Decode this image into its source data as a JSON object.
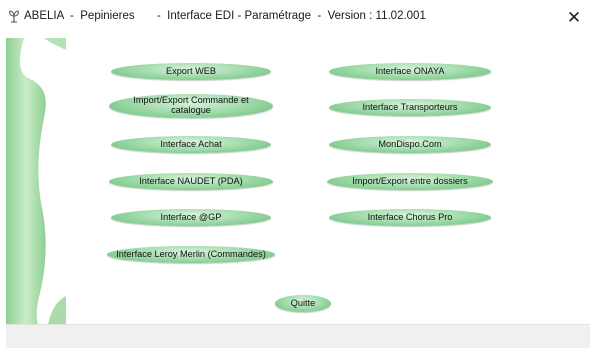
{
  "window": {
    "title": "ABELIA  -  Pepinieres       -  Interface EDI - Paramétrage  -  Version : 11.02.001",
    "app_icon": "plant-icon",
    "close_symbol": "✕"
  },
  "menu": {
    "left": [
      "Export WEB",
      "Import/Export Commande et catalogue",
      "Interface Achat",
      "Interface NAUDET  (PDA)",
      "Interface @GP",
      "Interface Leroy Merlin (Commandes)"
    ],
    "right": [
      "Interface ONAYA",
      "Interface Transporteurs",
      "MonDispo.Com",
      "Import/Export entre dossiers",
      "Interface Chorus Pro"
    ],
    "quit": "Quitte"
  },
  "colors": {
    "button_green": "#8fd39b",
    "decor_green": "#b6e3b6"
  }
}
